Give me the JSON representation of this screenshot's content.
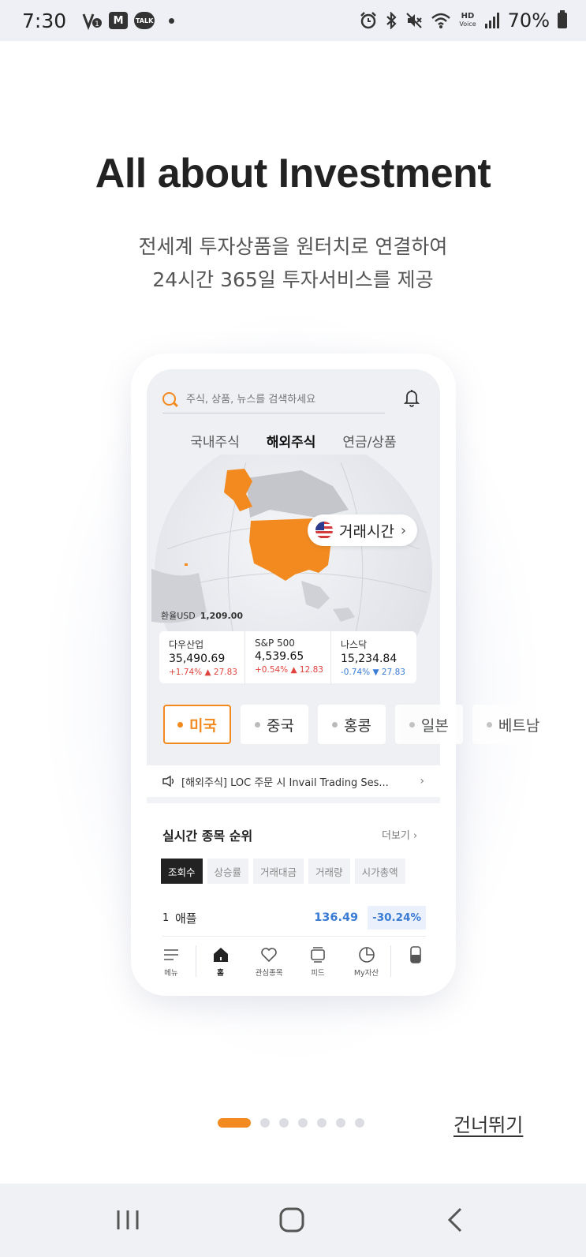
{
  "status_bar": {
    "time": "7:30",
    "left_icons": [
      "volte-icon",
      "mstock-icon",
      "kakaotalk-icon",
      "dot-icon"
    ],
    "mstock_label": "M",
    "talk_label": "TALK",
    "hd_label": "HD",
    "voice_label": "Voice",
    "battery": "70%"
  },
  "hero": {
    "title": "All about Investment",
    "subtitle_line1": "전세계 투자상품을 원터치로 연결하여",
    "subtitle_line2": "24시간 365일 투자서비스를 제공"
  },
  "app": {
    "search_placeholder": "주식, 상품, 뉴스를 검색하세요",
    "tabs": [
      {
        "label": "국내주식",
        "active": false
      },
      {
        "label": "해외주식",
        "active": true
      },
      {
        "label": "연금/상품",
        "active": false
      }
    ],
    "trade_time_label": "거래시간",
    "fx_label": "환율USD",
    "fx_value": "1,209.00",
    "indices": [
      {
        "name": "다우산업",
        "value": "35,490.69",
        "change": "+1.74% ▲ 27.83",
        "direction": "up"
      },
      {
        "name": "S&P 500",
        "value": "4,539.65",
        "change": "+0.54% ▲ 12.83",
        "direction": "up"
      },
      {
        "name": "나스닥",
        "value": "15,234.84",
        "change": "-0.74% ▼ 27.83",
        "direction": "down"
      }
    ],
    "countries": [
      {
        "label": "미국",
        "active": true
      },
      {
        "label": "중국",
        "active": false
      },
      {
        "label": "홍콩",
        "active": false
      },
      {
        "label": "일본",
        "active": false
      },
      {
        "label": "베트남",
        "active": false
      }
    ],
    "notice": "[해외주식] LOC 주문 시 Invail Trading Ses...",
    "ranking_title": "실시간 종목 순위",
    "ranking_more": "더보기",
    "ranking_chips": [
      "조회수",
      "상승률",
      "거래대금",
      "거래량",
      "시가총액"
    ],
    "ranking_rows": [
      {
        "rank": "1",
        "name": "애플",
        "price": "136.49",
        "change": "-30.24%"
      }
    ],
    "bottom_nav": [
      {
        "label": "메뉴",
        "icon": "menu-icon"
      },
      {
        "label": "홈",
        "icon": "home-icon"
      },
      {
        "label": "관심종목",
        "icon": "heart-icon"
      },
      {
        "label": "피드",
        "icon": "feed-icon"
      },
      {
        "label": "My자산",
        "icon": "pie-chart-icon"
      }
    ]
  },
  "pager": {
    "total_pages": 7,
    "current_page": 1
  },
  "skip_label": "건너뛰기",
  "colors": {
    "accent": "#f28a20",
    "up": "#e0433d",
    "down": "#3a7bd5"
  }
}
